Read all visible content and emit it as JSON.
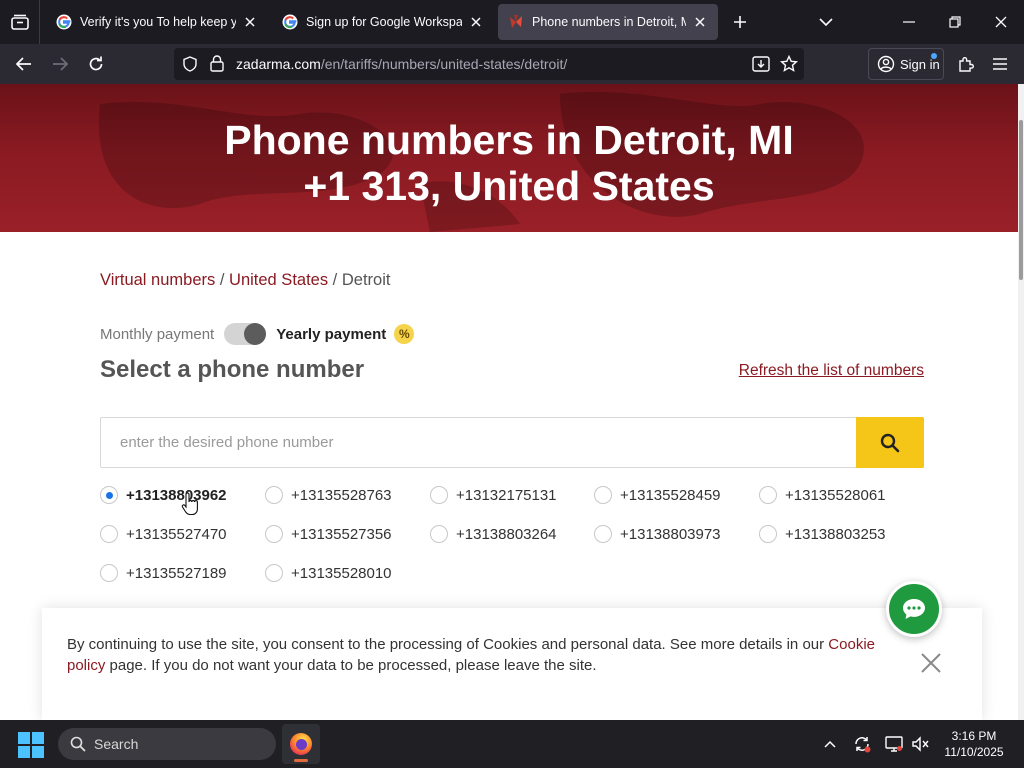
{
  "browser": {
    "tabs": [
      {
        "title": "Verify it's you To help keep your",
        "favicon": "google-icon",
        "active": false
      },
      {
        "title": "Sign up for Google Workspace",
        "favicon": "google-icon",
        "active": false
      },
      {
        "title": "Phone numbers in Detroit, MI U",
        "favicon": "zadarma-icon",
        "active": true
      }
    ],
    "url_host": "zadarma.com",
    "url_path": "/en/tariffs/numbers/united-states/detroit/",
    "sign_in_label": "Sign in"
  },
  "hero": {
    "title_line1": "Phone numbers in Detroit, MI",
    "title_line2": "+1 313, United States"
  },
  "breadcrumb": {
    "item1": "Virtual numbers",
    "sep1": " / ",
    "item2": "United States",
    "sep2": " / ",
    "current": "Detroit"
  },
  "payment": {
    "monthly_label": "Monthly payment",
    "yearly_label": "Yearly payment",
    "discount_badge": "%",
    "selected": "yearly"
  },
  "select_section": {
    "title": "Select a phone number",
    "refresh_label": "Refresh the list of numbers",
    "search_placeholder": "enter the desired phone number"
  },
  "numbers": [
    {
      "number": "+13138803962",
      "selected": true
    },
    {
      "number": "+13135528763",
      "selected": false
    },
    {
      "number": "+13132175131",
      "selected": false
    },
    {
      "number": "+13135528459",
      "selected": false
    },
    {
      "number": "+13135528061",
      "selected": false
    },
    {
      "number": "+13135527470",
      "selected": false
    },
    {
      "number": "+13135527356",
      "selected": false
    },
    {
      "number": "+13138803264",
      "selected": false
    },
    {
      "number": "+13138803973",
      "selected": false
    },
    {
      "number": "+13138803253",
      "selected": false
    },
    {
      "number": "+13135527189",
      "selected": false
    },
    {
      "number": "+13135528010",
      "selected": false
    }
  ],
  "cookie_banner": {
    "text_before": "By continuing to use the site, you consent to the processing of Cookies and personal data. See more details in our ",
    "link_text": "Cookie policy",
    "text_after": " page. If you do not want your data to be processed, please leave the site."
  },
  "taskbar": {
    "search_label": "Search",
    "time": "3:16 PM",
    "date": "11/10/2025"
  },
  "colors": {
    "brand_red": "#8a1a22",
    "search_button": "#f5c518",
    "chat_green": "#1f9a3e",
    "radio_selected": "#1a73e8"
  }
}
